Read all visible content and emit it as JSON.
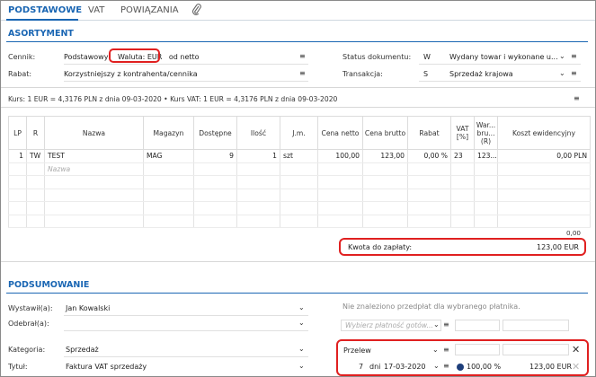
{
  "tabs": {
    "podstawowe": "PODSTAWOWE",
    "vat": "VAT",
    "powiazania": "POWIĄZANIA",
    "attach_icon": "paperclip-icon"
  },
  "sections": {
    "asortyment": "ASORTYMENT",
    "podsumowanie": "PODSUMOWANIE"
  },
  "form": {
    "cennik_label": "Cennik:",
    "cennik_value_1": "Podstawowy",
    "cennik_waluta": "Waluta: EUR",
    "cennik_value_2": "od netto",
    "rabat_label": "Rabat:",
    "rabat_value": "Korzystniejszy z kontrahenta/cennika",
    "status_label": "Status dokumentu:",
    "status_code": "W",
    "status_value": "Wydany towar i wykonane u...",
    "transakcja_label": "Transakcja:",
    "transakcja_code": "S",
    "transakcja_value": "Sprzedaż krajowa"
  },
  "kurs": "Kurs: 1 EUR = 4,3176 PLN z dnia 09-03-2020 • Kurs VAT: 1 EUR = 4,3176 PLN z dnia 09-03-2020",
  "grid": {
    "headers": {
      "lp": "LP",
      "r": "R",
      "nazwa": "Nazwa",
      "magazyn": "Magazyn",
      "dostepne": "Dostępne",
      "ilosc": "Ilość",
      "jm": "J.m.",
      "cena_netto": "Cena netto",
      "cena_brutto": "Cena brutto",
      "rabat": "Rabat",
      "vat_1": "VAT",
      "vat_2": "[%]",
      "war_1": "War...",
      "war_2": "bru...",
      "war_3": "(R)",
      "koszt": "Koszt ewidencyjny"
    },
    "row": {
      "lp": "1",
      "r": "TW",
      "nazwa": "TEST",
      "magazyn": "MAG",
      "dostepne": "9",
      "ilosc": "1",
      "jm": "szt",
      "cena_netto": "100,00",
      "cena_brutto": "123,00",
      "rabat": "0,00 %",
      "vat": "23",
      "war": "123....",
      "koszt": "0,00 PLN"
    },
    "new_row_placeholder": "Nazwa",
    "total": "0,00"
  },
  "kwota": {
    "label": "Kwota do zapłaty:",
    "value": "123,00 EUR"
  },
  "summary": {
    "wystawil_label": "Wystawił(a):",
    "wystawil_value": "Jan Kowalski",
    "odebral_label": "Odebrał(a):",
    "odebral_value": "",
    "kategoria_label": "Kategoria:",
    "kategoria_value": "Sprzedaż",
    "tytul_label": "Tytuł:",
    "tytul_value": "Faktura VAT sprzedaży",
    "predplaty_note": "Nie znaleziono przedpłat dla wybranego płatnika.",
    "platnosc_placeholder": "Wybierz płatność gotów...",
    "przelew": "Przelew",
    "dni": "7",
    "dni_label": "dni",
    "termin": "17-03-2020",
    "procent": "100,00 %",
    "kwota": "123,00 EUR"
  }
}
